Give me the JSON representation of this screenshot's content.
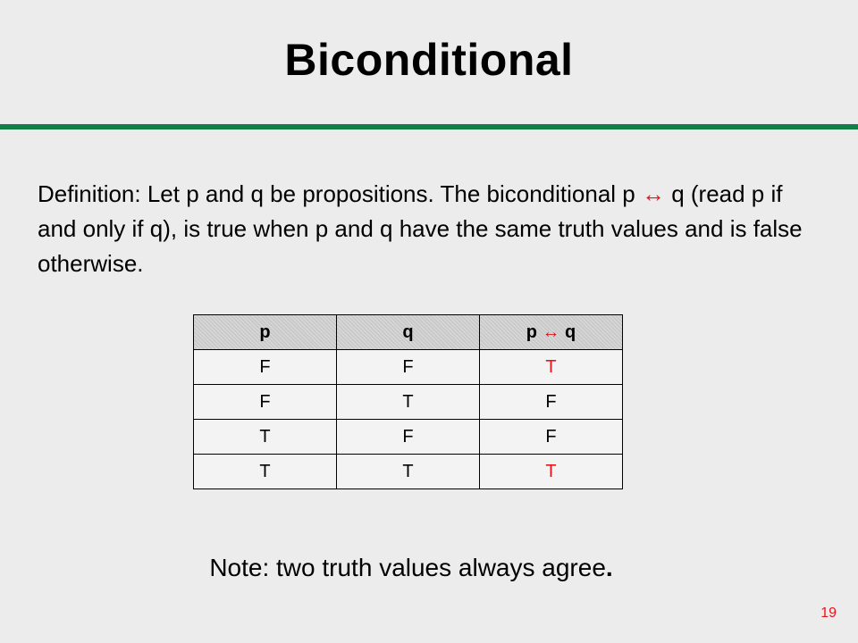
{
  "slide": {
    "title": "Biconditional",
    "definition_part1": "Definition: Let p and q be propositions. The biconditional p ",
    "arrow_symbol": "↔",
    "definition_part2": " q (read p if and only if q), is true when p and q have the same truth values and is false otherwise.",
    "note_text": "Note: two truth values always agree",
    "note_period": ".",
    "page_number": "19"
  },
  "table": {
    "headers": [
      "p",
      "q"
    ],
    "header3_left": "p ",
    "header3_arrow": "↔",
    "header3_right": " q",
    "rows": [
      [
        "F",
        "F",
        "T"
      ],
      [
        "F",
        "T",
        "F"
      ],
      [
        "T",
        "F",
        "F"
      ],
      [
        "T",
        "T",
        "T"
      ]
    ]
  },
  "colors": {
    "accent_rule": "#128046",
    "highlight": "#e8141b",
    "background": "#ececec"
  }
}
